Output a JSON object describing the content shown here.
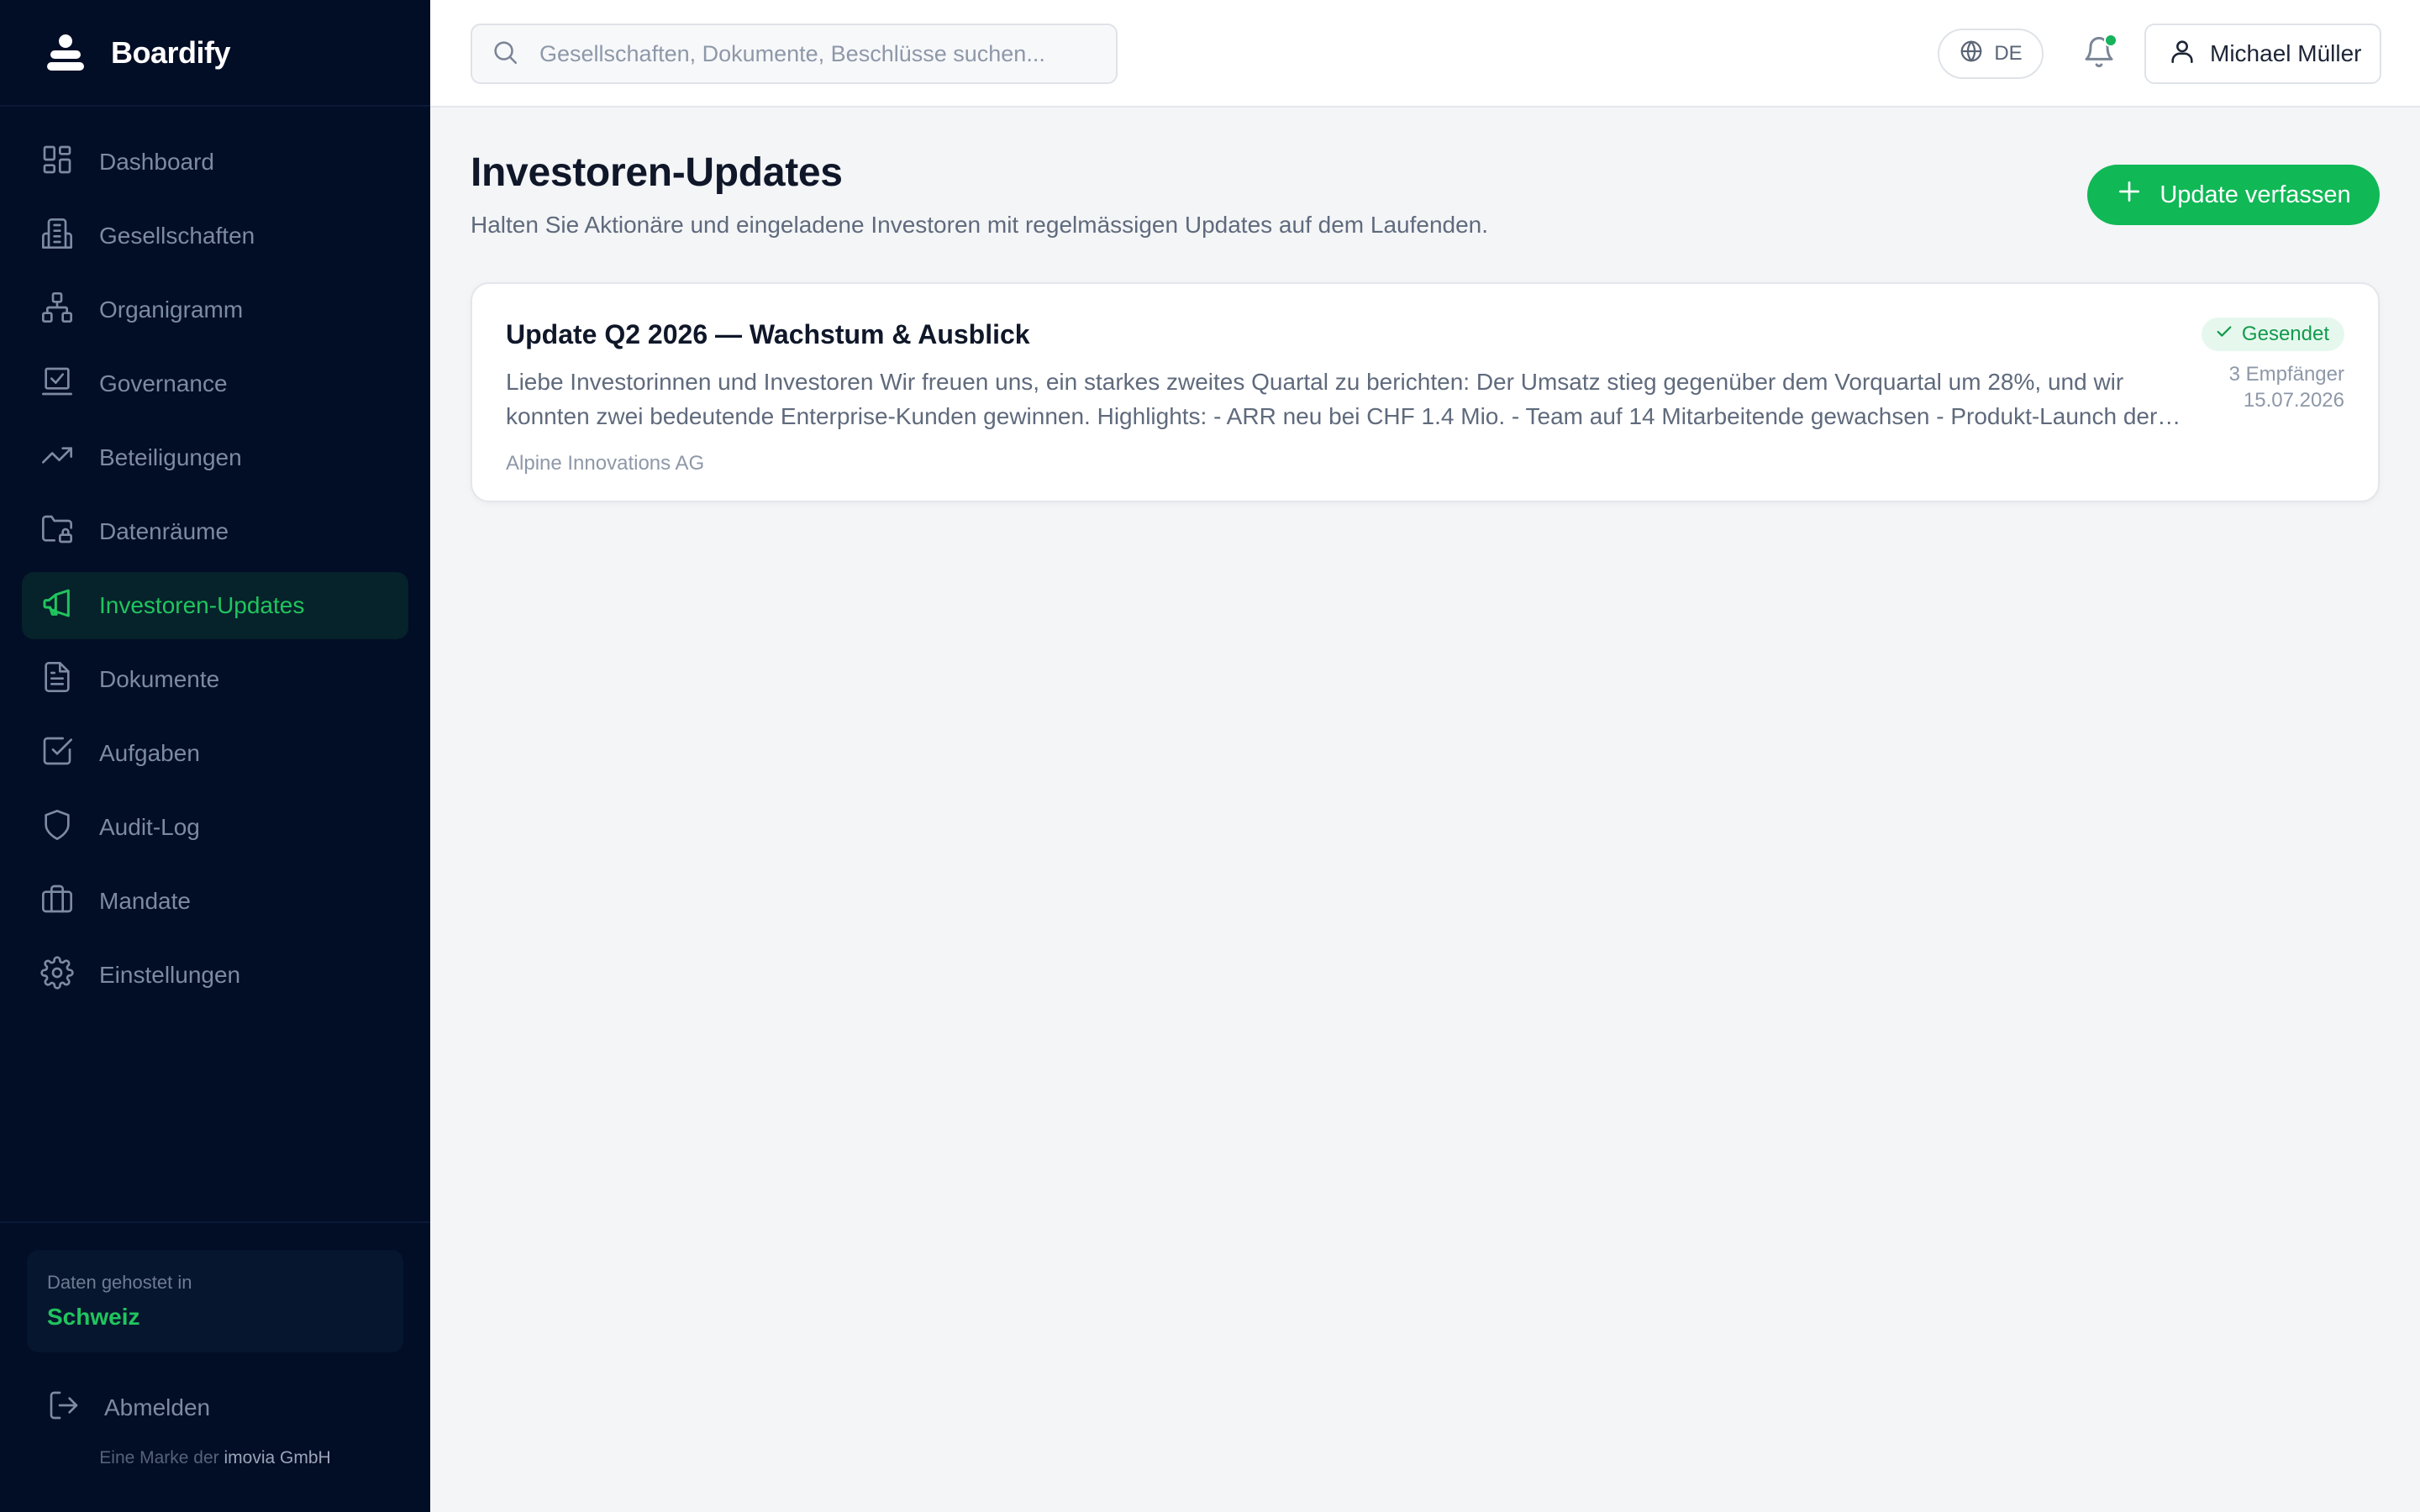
{
  "app": {
    "name": "Boardify"
  },
  "sidebar": {
    "items": [
      {
        "label": "Dashboard",
        "icon": "dashboard-icon",
        "active": false
      },
      {
        "label": "Gesellschaften",
        "icon": "building-icon",
        "active": false
      },
      {
        "label": "Organigramm",
        "icon": "org-chart-icon",
        "active": false
      },
      {
        "label": "Governance",
        "icon": "governance-icon",
        "active": false
      },
      {
        "label": "Beteiligungen",
        "icon": "trending-up-icon",
        "active": false
      },
      {
        "label": "Datenräume",
        "icon": "folder-lock-icon",
        "active": false
      },
      {
        "label": "Investoren-Updates",
        "icon": "megaphone-icon",
        "active": true
      },
      {
        "label": "Dokumente",
        "icon": "document-icon",
        "active": false
      },
      {
        "label": "Aufgaben",
        "icon": "checkbox-icon",
        "active": false
      },
      {
        "label": "Audit-Log",
        "icon": "shield-icon",
        "active": false
      },
      {
        "label": "Mandate",
        "icon": "briefcase-icon",
        "active": false
      },
      {
        "label": "Einstellungen",
        "icon": "gear-icon",
        "active": false
      }
    ],
    "hosting": {
      "label": "Daten gehostet in",
      "value": "Schweiz"
    },
    "logout_label": "Abmelden",
    "footer_prefix": "Eine Marke der",
    "footer_company": "imovia GmbH"
  },
  "topbar": {
    "search_placeholder": "Gesellschaften, Dokumente, Beschlüsse suchen...",
    "language": "DE",
    "user_name": "Michael Müller"
  },
  "page": {
    "title": "Investoren-Updates",
    "subtitle": "Halten Sie Aktionäre und eingeladene Investoren mit regelmässigen Updates auf dem Laufenden.",
    "compose_label": "Update verfassen"
  },
  "updates": [
    {
      "title": "Update Q2 2026 — Wachstum & Ausblick",
      "excerpt": "Liebe Investorinnen und Investoren Wir freuen uns, ein starkes zweites Quartal zu berichten: Der Umsatz stieg gegenüber dem Vorquartal um 28%, und wir konnten zwei bedeutende Enterprise-Kunden gewinnen. Highlights: - ARR neu bei CHF 1.4 Mio. - Team auf 14 Mitarbeitende gewachsen - Produkt-Launch der neuen Version",
      "company": "Alpine Innovations AG",
      "status": "Gesendet",
      "recipients": "3 Empfänger",
      "date": "15.07.2026"
    }
  ],
  "colors": {
    "sidebar_bg": "#020d26",
    "accent": "#10b856",
    "active_text": "#20c55e"
  }
}
